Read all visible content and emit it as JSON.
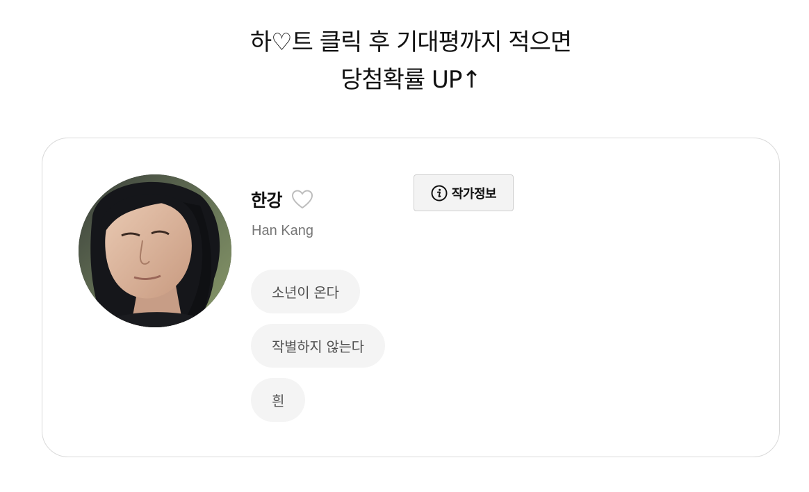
{
  "headline": {
    "line1": "하♡트 클릭 후 기대평까지 적으면",
    "line2": "당첨확률 UP↑"
  },
  "author": {
    "name": "한강",
    "name_en": "Han Kang",
    "info_button_label": "작가정보",
    "photo_alt": "한강",
    "books": [
      {
        "title": "소년이 온다"
      },
      {
        "title": "작별하지 않는다"
      },
      {
        "title": "흰"
      }
    ]
  },
  "colors": {
    "card_border": "#d9d9d9",
    "chip_bg": "#f4f4f4",
    "secondary_text": "#767676",
    "button_bg": "#f3f3f3"
  },
  "icons": {
    "like": "heart-outline-icon",
    "info": "info-circle-icon"
  }
}
